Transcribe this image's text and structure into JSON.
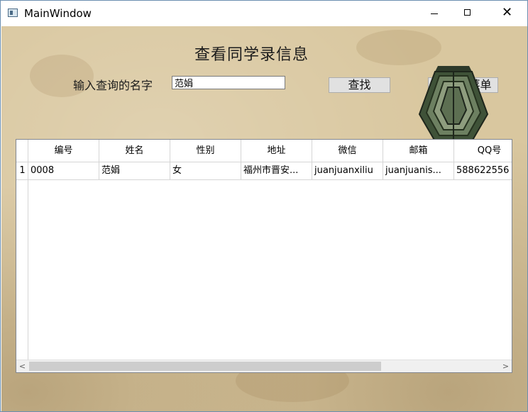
{
  "window": {
    "title": "MainWindow",
    "controls": {
      "minimize": "—",
      "maximize": "☐",
      "close": "✕"
    }
  },
  "page": {
    "title": "查看同学录信息",
    "search_label": "输入查询的名字",
    "search_value": "范娟",
    "search_button": "查找",
    "back_button": "返回主菜单"
  },
  "table": {
    "columns": [
      "编号",
      "姓名",
      "性别",
      "地址",
      "微信",
      "邮箱",
      "QQ号"
    ],
    "rows": [
      {
        "row_number": "1",
        "cells": [
          "0008",
          "范娟",
          "女",
          "福州市晋安...",
          "juanjuanxiliu",
          "juanjuanis...",
          "588622556"
        ]
      }
    ]
  },
  "scrollbar": {
    "left_arrow": "<",
    "right_arrow": ">"
  },
  "colors": {
    "background": "#d9c79f",
    "button_bg": "#e1e1e1",
    "table_border": "#828790",
    "grid_line": "#d5d5d5"
  }
}
